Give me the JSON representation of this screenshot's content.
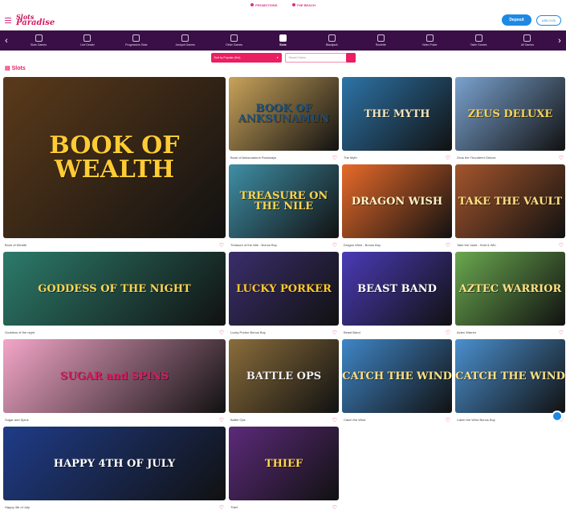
{
  "topstrip": {
    "promotions": "PROMOTIONS",
    "beach": "THE BEACH"
  },
  "header": {
    "logo_line1": "Slots",
    "logo_line2": "Paradise",
    "deposit_label": "Deposit",
    "balance_label": "USD 0.00"
  },
  "nav": {
    "items": [
      {
        "label": "Slots Games",
        "icon": "home-icon"
      },
      {
        "label": "Live Dealer",
        "icon": "dealer-icon"
      },
      {
        "label": "Progressive Slots",
        "icon": "progressive-icon"
      },
      {
        "label": "Jackpot Games",
        "icon": "jackpot-icon"
      },
      {
        "label": "Other Games",
        "icon": "other-icon"
      },
      {
        "label": "Slots",
        "icon": "slot-icon",
        "active": true
      },
      {
        "label": "Blackjack",
        "icon": "cards-icon"
      },
      {
        "label": "Roulette",
        "icon": "roulette-icon"
      },
      {
        "label": "Video Poker",
        "icon": "poker-icon"
      },
      {
        "label": "Table Games",
        "icon": "table-icon"
      },
      {
        "label": "All Games",
        "icon": "grid-icon"
      }
    ]
  },
  "filters": {
    "sort_label": "Sort by Popular (Hot)",
    "search_placeholder": "Search Game"
  },
  "section": {
    "title": "Slots"
  },
  "games": [
    {
      "name": "Book of Wealth",
      "art": "BOOK OF WEALTH",
      "bg": "#5b3a1a",
      "fg": "#ffcc33"
    },
    {
      "name": "Book of Anksunamun Rockways",
      "art": "BOOK OF ANKSUNAMUN",
      "bg": "#c9a35a",
      "fg": "#1d4f7a"
    },
    {
      "name": "The Myth",
      "art": "THE MYTH",
      "bg": "#2d74a8",
      "fg": "#f2e3b8"
    },
    {
      "name": "Zeus the Thunderer Deluxe",
      "art": "ZEUS DELUXE",
      "bg": "#7aa2cf",
      "fg": "#f7d35a"
    },
    {
      "name": "Treasure of the Nile - Bonus Buy",
      "art": "TREASURE ON THE NILE",
      "bg": "#3f8fa6",
      "fg": "#ffd54f"
    },
    {
      "name": "Dragon Wish - Bonus Buy",
      "art": "DRAGON WISH",
      "bg": "#e86a2a",
      "fg": "#fff3c4"
    },
    {
      "name": "Take the Vault - Hold & Win",
      "art": "TAKE THE VAULT",
      "bg": "#a4552c",
      "fg": "#ffe082"
    },
    {
      "name": "Goddess of the night",
      "art": "GODDESS OF THE NIGHT",
      "bg": "#2c7b6a",
      "fg": "#ffd54f"
    },
    {
      "name": "Lucky Porker Bonus Buy",
      "art": "LUCKY PORKER",
      "bg": "#3a2e6b",
      "fg": "#ffca28"
    },
    {
      "name": "Beast Band",
      "art": "BEAST BAND",
      "bg": "#4a3bb7",
      "fg": "#ffffff"
    },
    {
      "name": "Aztec Warrior",
      "art": "AZTEC WARRIOR",
      "bg": "#6aa84f",
      "fg": "#ffe082"
    },
    {
      "name": "Sugar and Spins",
      "art": "SUGAR and SPINS",
      "bg": "#f3a6c8",
      "fg": "#d81b60"
    },
    {
      "name": "Battle Ops",
      "art": "BATTLE OPS",
      "bg": "#8a6d3b",
      "fg": "#f0f0f0"
    },
    {
      "name": "Catch the Wind",
      "art": "CATCH THE WIND",
      "bg": "#3f86c7",
      "fg": "#ffe082"
    },
    {
      "name": "Catch the Wind Bonus Buy",
      "art": "CATCH THE WIND",
      "bg": "#4a90cf",
      "fg": "#ffe082"
    },
    {
      "name": "Happy 4th of July",
      "art": "HAPPY 4TH OF JULY",
      "bg": "#1f3c88",
      "fg": "#ffffff"
    },
    {
      "name": "Thief",
      "art": "THIEF",
      "bg": "#5c2a7a",
      "fg": "#ffd54f"
    }
  ]
}
